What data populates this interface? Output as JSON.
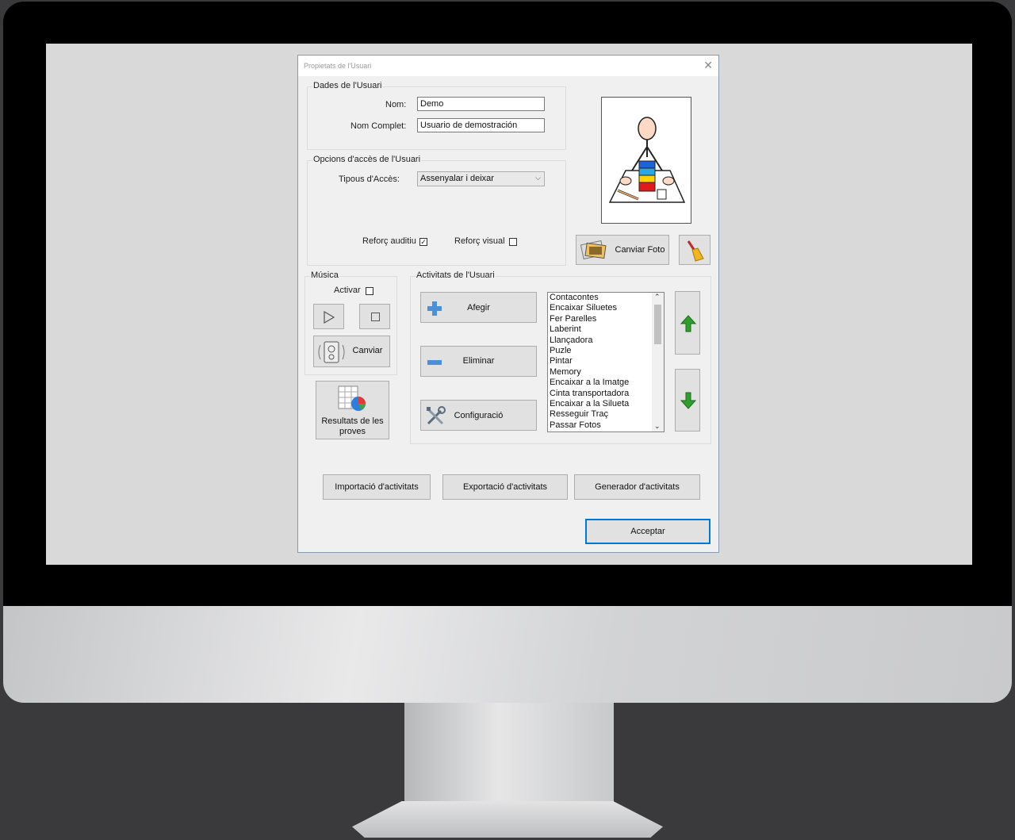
{
  "dialog": {
    "title": "Propietats de l'Usuari",
    "close_glyph": "✕"
  },
  "user_data": {
    "group_label": "Dades de l'Usuari",
    "name_label": "Nom:",
    "name_value": "Demo",
    "fullname_label": "Nom Complet:",
    "fullname_value": "Usuario de demostración"
  },
  "access": {
    "group_label": "Opcions d'accès de l'Usuari",
    "type_label": "Tipous d'Accès:",
    "type_value": "Assenyalar i deixar",
    "auditory_label": "Reforç auditiu",
    "auditory_checked": true,
    "visual_label": "Reforç visual",
    "visual_checked": false
  },
  "photo": {
    "change_label": "Canviar Foto"
  },
  "music": {
    "group_label": "Música",
    "activate_label": "Activar",
    "activate_checked": false,
    "change_label": "Canviar"
  },
  "activities": {
    "group_label": "Activitats de l'Usuari",
    "add_label": "Afegir",
    "remove_label": "Eliminar",
    "config_label": "Configuració",
    "items": [
      "Contacontes",
      "Encaixar Siluetes",
      "Fer Parelles",
      "Laberint",
      "Llançadora",
      "Puzle",
      "Pintar",
      "Memory",
      "Encaixar a la Imatge",
      "Cinta transportadora",
      "Encaixar a la Silueta",
      "Resseguir Traç",
      "Passar Fotos"
    ]
  },
  "results": {
    "label_line1": "Resultats de les",
    "label_line2": "proves"
  },
  "footer": {
    "import_label": "Importació d'activitats",
    "export_label": "Exportació d'activitats",
    "generator_label": "Generador d'activitats",
    "accept_label": "Acceptar"
  },
  "colors": {
    "dialog_bg": "#f0f0f0",
    "accent_border": "#0078d7",
    "arrow_green": "#2e9e2e"
  }
}
